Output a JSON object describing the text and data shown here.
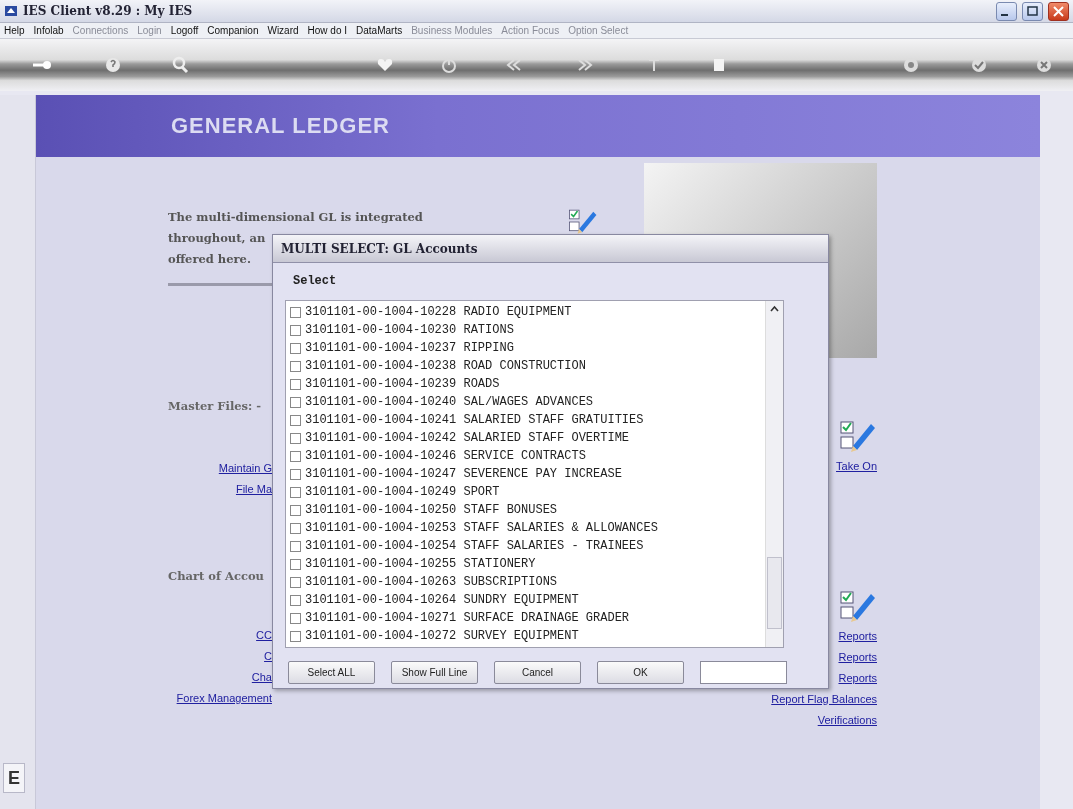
{
  "window": {
    "title": "IES Client v8.29 : My IES"
  },
  "menu": [
    {
      "label": "Help",
      "disabled": false
    },
    {
      "label": "Infolab",
      "disabled": false
    },
    {
      "label": "Connections",
      "disabled": true
    },
    {
      "label": "Login",
      "disabled": true
    },
    {
      "label": "Logoff",
      "disabled": false
    },
    {
      "label": "Companion",
      "disabled": false
    },
    {
      "label": "Wizard",
      "disabled": false
    },
    {
      "label": "How do I",
      "disabled": false
    },
    {
      "label": "DataMarts",
      "disabled": false
    },
    {
      "label": "Business Modules",
      "disabled": true
    },
    {
      "label": "Action Focus",
      "disabled": true
    },
    {
      "label": "Option Select",
      "disabled": true
    }
  ],
  "page": {
    "heading": "GENERAL LEDGER",
    "intro": [
      "The multi-dimensional GL is integrated",
      "throughout, an",
      "offered here."
    ],
    "sections": [
      {
        "label": "Master Files: -",
        "left_links": [
          "Maintain G",
          "File Ma"
        ],
        "right_links": [
          "Take On"
        ]
      },
      {
        "label": "Chart of Accou",
        "left_links": [
          "CC",
          "C",
          "Cha",
          "Forex Management"
        ],
        "right_links": [
          "Reports",
          "Reports",
          "Reports",
          "Report Flag Balances",
          "Verifications"
        ]
      }
    ]
  },
  "side_strip": {
    "label": "E"
  },
  "dialog": {
    "title": "MULTI SELECT: GL Accounts",
    "prompt": "Select",
    "items": [
      {
        "code": "3101101-00-1004-10228",
        "name": "RADIO EQUIPMENT",
        "checked": false
      },
      {
        "code": "3101101-00-1004-10230",
        "name": "RATIONS",
        "checked": false
      },
      {
        "code": "3101101-00-1004-10237",
        "name": "RIPPING",
        "checked": false
      },
      {
        "code": "3101101-00-1004-10238",
        "name": "ROAD CONSTRUCTION",
        "checked": false
      },
      {
        "code": "3101101-00-1004-10239",
        "name": "ROADS",
        "checked": false
      },
      {
        "code": "3101101-00-1004-10240",
        "name": "SAL/WAGES ADVANCES",
        "checked": false
      },
      {
        "code": "3101101-00-1004-10241",
        "name": "SALARIED STAFF GRATUITIES",
        "checked": false
      },
      {
        "code": "3101101-00-1004-10242",
        "name": "SALARIED STAFF OVERTIME",
        "checked": false
      },
      {
        "code": "3101101-00-1004-10246",
        "name": "SERVICE CONTRACTS",
        "checked": false
      },
      {
        "code": "3101101-00-1004-10247",
        "name": "SEVERENCE PAY INCREASE",
        "checked": false
      },
      {
        "code": "3101101-00-1004-10249",
        "name": "SPORT",
        "checked": false
      },
      {
        "code": "3101101-00-1004-10250",
        "name": "STAFF BONUSES",
        "checked": false
      },
      {
        "code": "3101101-00-1004-10253",
        "name": "STAFF SALARIES & ALLOWANCES",
        "checked": false
      },
      {
        "code": "3101101-00-1004-10254",
        "name": "STAFF SALARIES - TRAINEES",
        "checked": false
      },
      {
        "code": "3101101-00-1004-10255",
        "name": "STATIONERY",
        "checked": false
      },
      {
        "code": "3101101-00-1004-10263",
        "name": "SUBSCRIPTIONS",
        "checked": false
      },
      {
        "code": "3101101-00-1004-10264",
        "name": "SUNDRY EQUIPMENT",
        "checked": false
      },
      {
        "code": "3101101-00-1004-10271",
        "name": "SURFACE DRAINAGE GRADER",
        "checked": false
      },
      {
        "code": "3101101-00-1004-10272",
        "name": "SURVEY EQUIPMENT",
        "checked": false
      }
    ],
    "buttons": [
      "Select ALL",
      "Show Full Line",
      "Cancel",
      "OK"
    ]
  }
}
